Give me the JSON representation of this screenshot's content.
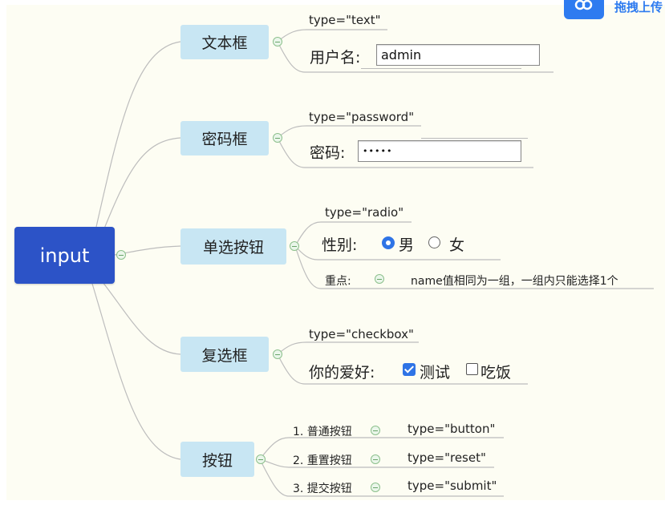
{
  "corner_label": "拖拽上传",
  "root": "input",
  "branches": {
    "text": {
      "label": "文本框",
      "type": "type=\"text\"",
      "field_label": "用户名:",
      "field_value": "admin"
    },
    "password": {
      "label": "密码框",
      "type": "type=\"password\"",
      "field_label": "密码:",
      "field_value": "•••••"
    },
    "radio": {
      "label": "单选按钮",
      "type": "type=\"radio\"",
      "field_label": "性别:",
      "options": [
        "男",
        "女"
      ],
      "selected": "男",
      "note_label": "重点:",
      "note_text": "name值相同为一组，一组内只能选择1个"
    },
    "checkbox": {
      "label": "复选框",
      "type": "type=\"checkbox\"",
      "field_label": "你的爱好:",
      "options": [
        "测试",
        "吃饭"
      ],
      "checked": [
        "测试"
      ]
    },
    "button": {
      "label": "按钮",
      "items": [
        {
          "name": "1. 普通按钮",
          "type": "type=\"button\""
        },
        {
          "name": "2. 重置按钮",
          "type": "type=\"reset\""
        },
        {
          "name": "3. 提交按钮",
          "type": "type=\"submit\""
        }
      ]
    }
  },
  "colors": {
    "root_fill": "#2c53c7",
    "branch_fill": "#c8e6f3",
    "link": "#bdbdbd",
    "radio_checkbox_accent": "#2f74e6",
    "background": "#fdfdf3"
  }
}
